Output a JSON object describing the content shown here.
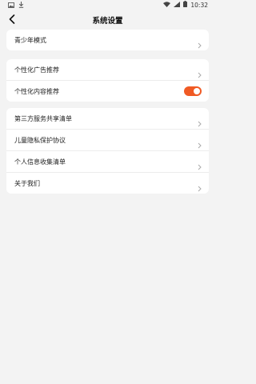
{
  "status_bar": {
    "time": "10:32",
    "icons": [
      "photo-icon",
      "download-icon",
      "wifi-icon",
      "signal-icon",
      "battery-icon"
    ]
  },
  "header": {
    "title": "系统设置",
    "back_icon": "chevron-left-icon"
  },
  "groups": [
    {
      "items": [
        {
          "label": "青少年模式",
          "type": "link"
        }
      ]
    },
    {
      "items": [
        {
          "label": "个性化广告推荐",
          "type": "link"
        },
        {
          "label": "个性化内容推荐",
          "type": "toggle",
          "on": true
        }
      ]
    },
    {
      "items": [
        {
          "label": "第三方服务共享清单",
          "type": "link"
        },
        {
          "label": "儿童隐私保护协议",
          "type": "link"
        },
        {
          "label": "个人信息收集清单",
          "type": "link"
        },
        {
          "label": "关于我们",
          "type": "link"
        }
      ]
    }
  ],
  "colors": {
    "accent": "#f05a24",
    "background": "#f3f3f3",
    "card": "#ffffff"
  }
}
